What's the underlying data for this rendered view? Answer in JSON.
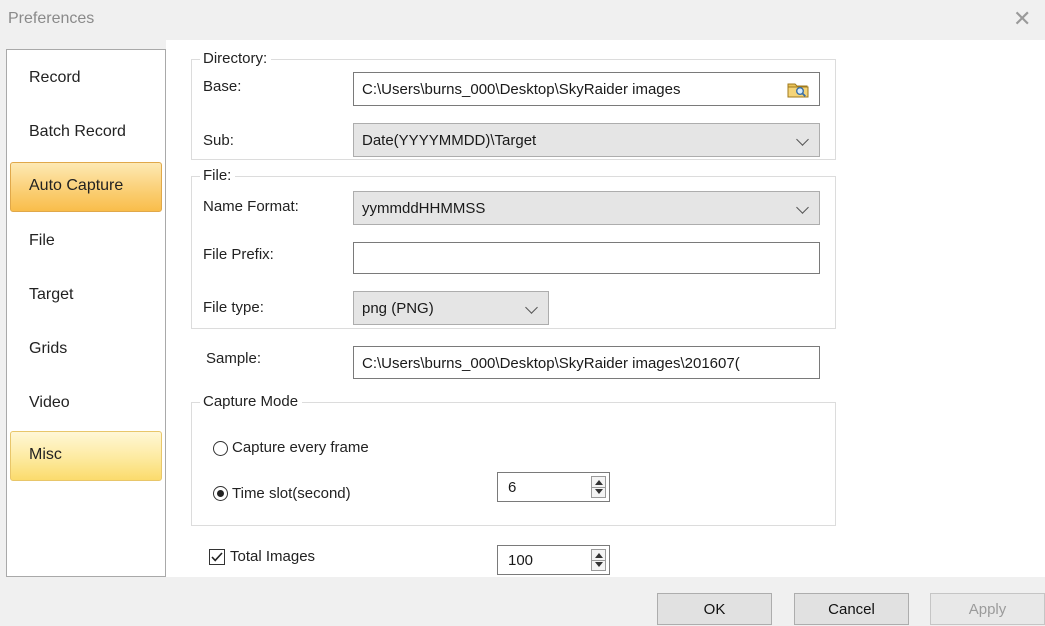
{
  "window": {
    "title": "Preferences",
    "close_glyph": "✕"
  },
  "sidebar": {
    "items": [
      {
        "label": "Record"
      },
      {
        "label": "Batch Record"
      },
      {
        "label": "Auto Capture"
      },
      {
        "label": "File"
      },
      {
        "label": "Target"
      },
      {
        "label": "Grids"
      },
      {
        "label": "Video"
      },
      {
        "label": "Misc"
      }
    ],
    "active_index": 2
  },
  "directory": {
    "legend": "Directory:",
    "base_label": "Base:",
    "base_value": "C:\\Users\\burns_000\\Desktop\\SkyRaider images",
    "sub_label": "Sub:",
    "sub_value": "Date(YYYYMMDD)\\Target"
  },
  "file": {
    "legend": "File:",
    "name_format_label": "Name Format:",
    "name_format_value": "yymmddHHMMSS",
    "prefix_label": "File Prefix:",
    "prefix_value": "",
    "type_label": "File type:",
    "type_value": "png (PNG)"
  },
  "sample": {
    "label": "Sample:",
    "value": "C:\\Users\\burns_000\\Desktop\\SkyRaider images\\201607("
  },
  "capture_mode": {
    "legend": "Capture Mode",
    "option_every_frame": "Capture every frame",
    "option_time_slot": "Time slot(second)",
    "selected": "time_slot",
    "time_slot_value": "6"
  },
  "total_images": {
    "label": "Total Images",
    "checked": true,
    "value": "100"
  },
  "buttons": {
    "ok": "OK",
    "cancel": "Cancel",
    "apply": "Apply"
  }
}
